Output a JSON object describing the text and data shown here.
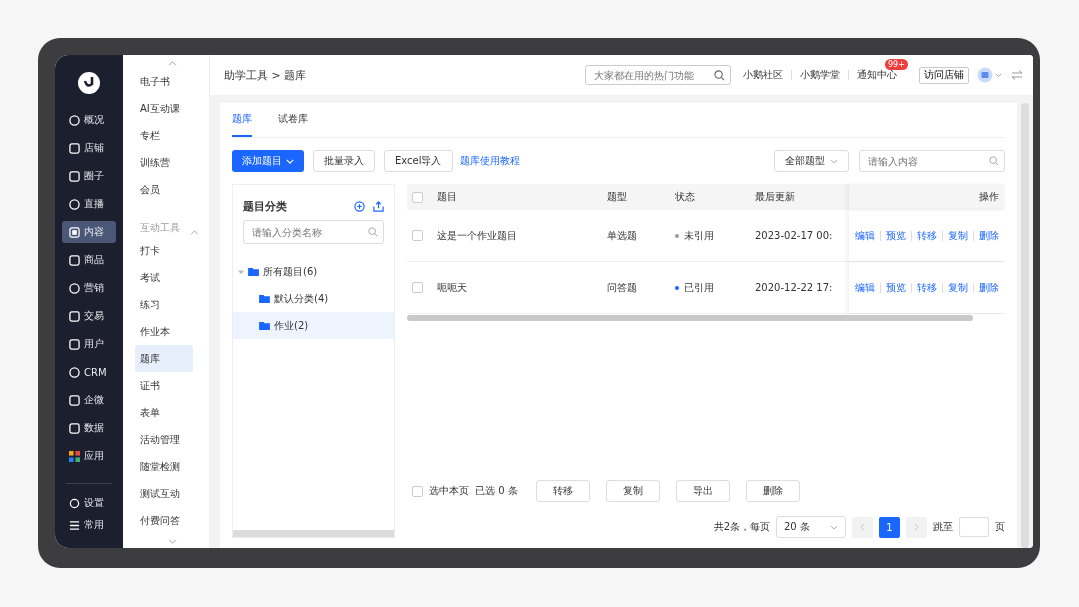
{
  "sidebar": {
    "items": [
      {
        "label": "概况",
        "selected": false
      },
      {
        "label": "店铺",
        "selected": false
      },
      {
        "label": "圈子",
        "selected": false
      },
      {
        "label": "直播",
        "selected": false
      },
      {
        "label": "内容",
        "selected": true
      },
      {
        "label": "商品",
        "selected": false
      },
      {
        "label": "营销",
        "selected": false
      },
      {
        "label": "交易",
        "selected": false
      },
      {
        "label": "用户",
        "selected": false
      },
      {
        "label": "CRM",
        "selected": false
      },
      {
        "label": "企微",
        "selected": false
      },
      {
        "label": "数据",
        "selected": false
      },
      {
        "label": "应用",
        "selected": false
      }
    ],
    "bottom": [
      {
        "label": "设置"
      },
      {
        "label": "常用"
      }
    ]
  },
  "subnav": {
    "items": [
      {
        "kind": "item",
        "label": "电子书",
        "selected": false
      },
      {
        "kind": "item",
        "label": "AI互动课",
        "selected": false
      },
      {
        "kind": "item",
        "label": "专栏",
        "selected": false
      },
      {
        "kind": "item",
        "label": "训练营",
        "selected": false
      },
      {
        "kind": "item",
        "label": "会员",
        "selected": false
      },
      {
        "kind": "section",
        "label": "互动工具",
        "expanded": true
      },
      {
        "kind": "item",
        "label": "打卡",
        "selected": false
      },
      {
        "kind": "item",
        "label": "考试",
        "selected": false
      },
      {
        "kind": "item",
        "label": "练习",
        "selected": false
      },
      {
        "kind": "item",
        "label": "作业本",
        "selected": false
      },
      {
        "kind": "item",
        "label": "题库",
        "selected": true
      },
      {
        "kind": "item",
        "label": "证书",
        "selected": false
      },
      {
        "kind": "item",
        "label": "表单",
        "selected": false
      },
      {
        "kind": "item",
        "label": "活动管理",
        "selected": false
      },
      {
        "kind": "item",
        "label": "随堂检测",
        "selected": false
      },
      {
        "kind": "item",
        "label": "测试互动",
        "selected": false
      },
      {
        "kind": "item",
        "label": "付费问答",
        "selected": false
      }
    ]
  },
  "header": {
    "breadcrumb": "助学工具 > 题库",
    "search": {
      "placeholder": "大家都在用的热门功能"
    },
    "links": [
      "小鹅社区",
      "小鹅学堂",
      "通知中心"
    ],
    "badge": "99+",
    "visit_button": "访问店铺"
  },
  "tabs": [
    {
      "label": "题库",
      "selected": true
    },
    {
      "label": "试卷库",
      "selected": false
    }
  ],
  "toolbar": {
    "add_button": "添加题目",
    "buttons": [
      "批量录入",
      "Excel导入"
    ],
    "link": "题库使用教程",
    "type_filter": "全部题型",
    "search": {
      "placeholder": "请输入内容"
    }
  },
  "categories": {
    "title": "题目分类",
    "search": {
      "placeholder": "请输入分类名称"
    },
    "tree": [
      {
        "label": "所有题目(6)",
        "expanded": true,
        "selected": false,
        "children": [
          {
            "label": "默认分类(4)",
            "selected": false
          },
          {
            "label": "作业(2)",
            "selected": true
          }
        ]
      }
    ]
  },
  "table": {
    "header_checked": false,
    "columns": [
      "题目",
      "题型",
      "状态",
      "最后更新",
      "操作"
    ],
    "rows": [
      {
        "checked": false,
        "title": "这是一个作业题目",
        "type": "单选题",
        "status": "未引用",
        "color": "#9a9a9a",
        "updated": "2023-02-17 00:",
        "actions": [
          "编辑",
          "预览",
          "转移",
          "复制",
          "删除"
        ]
      },
      {
        "checked": false,
        "title": "呃呃天",
        "type": "问答题",
        "status": "已引用",
        "color": "#1a66ff",
        "updated": "2020-12-22 17:",
        "actions": [
          "编辑",
          "预览",
          "转移",
          "复制",
          "删除"
        ]
      }
    ]
  },
  "bulk": {
    "select_page": {
      "label": "选中本页",
      "checked": false
    },
    "selected_count": "已选 0 条",
    "buttons": [
      "转移",
      "复制",
      "导出",
      "删除"
    ]
  },
  "pagination": {
    "total": "共2条，每页",
    "page_size": "20 条",
    "pages": [
      {
        "label": "1",
        "selected": true
      }
    ],
    "jump_label": "跳至",
    "page_unit": "页"
  }
}
